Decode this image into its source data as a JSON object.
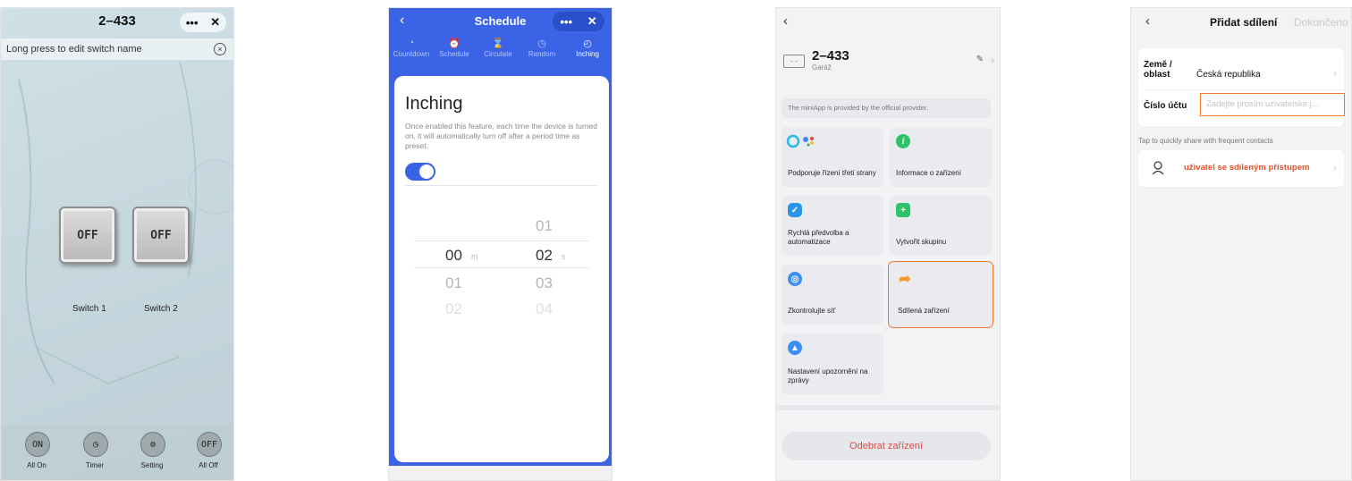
{
  "panel1": {
    "title": "2–433",
    "menu_dots": "•••",
    "close": "✕",
    "hint": "Long press to edit switch name",
    "hint_close": "×",
    "switches": [
      {
        "state": "OFF",
        "label": "Switch 1"
      },
      {
        "state": "OFF",
        "label": "Switch 2"
      }
    ],
    "bottom": [
      {
        "icon": "ON",
        "label": "All On"
      },
      {
        "icon": "◷",
        "label": "Timer"
      },
      {
        "icon": "⚙",
        "label": "Setting"
      },
      {
        "icon": "OFF",
        "label": "All Off"
      }
    ]
  },
  "panel2": {
    "back": "‹",
    "title": "Schedule",
    "menu_dots": "•••",
    "close": "✕",
    "tabs": [
      {
        "label": "Countdown",
        "icon": "◔"
      },
      {
        "label": "Schedule",
        "icon": "⏰"
      },
      {
        "label": "Circulate",
        "icon": "⌛"
      },
      {
        "label": "Random",
        "icon": "◷"
      },
      {
        "label": "Inching",
        "icon": "◴"
      }
    ],
    "active_tab": "Inching",
    "card_title": "Inching",
    "description": "Once enabled this feature,  each time the device is turned on, it will automatically turn off after a period time as preset.",
    "toggle_on": true,
    "picker": {
      "minutes": [
        "00",
        "01",
        "02"
      ],
      "minute_unit": "m",
      "seconds": [
        "01",
        "02",
        "03",
        "04"
      ],
      "second_unit": "s"
    }
  },
  "panel3": {
    "back": "‹",
    "device_name": "2–433",
    "room": "Garáž",
    "device_icon": "- -",
    "edit_icon": "✎",
    "chevron": "›",
    "provider_note": "The miniApp is provided by the official provider.",
    "tiles": [
      {
        "label": "Podporuje řízení třetí strany",
        "icon": "assistant-icon",
        "color": "#2ab7e8"
      },
      {
        "label": "Informace o zařízení",
        "icon": "info-icon",
        "color": "#2ec36b"
      },
      {
        "label": "Rychlá předvolba a automatizace",
        "icon": "automation-icon",
        "color": "#2a95e8"
      },
      {
        "label": "Vytvořit skupinu",
        "icon": "group-add-icon",
        "color": "#2ec36b"
      },
      {
        "label": "Zkontrolujte síť",
        "icon": "network-icon",
        "color": "#3d8ef5"
      },
      {
        "label": "Sdílená zařízení",
        "icon": "share-icon",
        "color": "#f59a2c"
      },
      {
        "label": "Nastavení upozornění na zprávy",
        "icon": "bell-icon",
        "color": "#3d8ef5"
      }
    ],
    "selected_tile": "Sdílená zařízení",
    "remove_button": "Odebrat zařízení"
  },
  "panel4": {
    "back": "‹",
    "title": "Přidat sdílení",
    "done": "Dokončeno",
    "country_label": "Země / oblast",
    "country_value": "Česká republika",
    "account_label": "Číslo účtu",
    "account_placeholder": "Zadejte prosím uzivatelske j...",
    "quick_share": "Tap to quickly share with frequent contacts",
    "contact_name": "uživatel se sdíleným přístupem",
    "chevron": "›"
  }
}
